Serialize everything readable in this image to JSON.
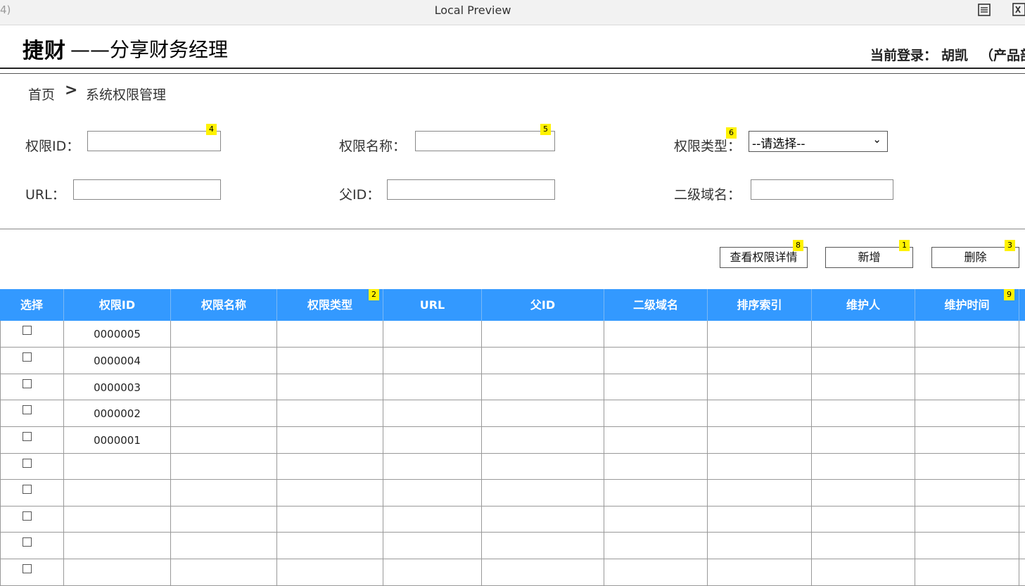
{
  "window": {
    "left_fragment": "4)",
    "title": "Local Preview"
  },
  "header": {
    "brand_bold": "捷财",
    "brand_rest": "——分享财务经理",
    "login_label": "当前登录：",
    "login_name": "胡凯",
    "login_dept": "（产品部"
  },
  "breadcrumb": {
    "home": "首页",
    "separator": ">",
    "current": "系统权限管理"
  },
  "form": {
    "perm_id_label": "权限ID：",
    "perm_name_label": "权限名称：",
    "perm_type_label": "权限类型：",
    "perm_type_value": "--请选择--",
    "url_label": "URL：",
    "parent_id_label": "父ID：",
    "subdomain_label": "二级域名："
  },
  "actions": {
    "view_detail": "查看权限详情",
    "add": "新增",
    "delete": "删除"
  },
  "badges": {
    "view_detail": "8",
    "add": "1",
    "delete": "3",
    "perm_type_col": "2",
    "maint_time_col": "9",
    "perm_id_input": "4",
    "perm_name_input": "5",
    "perm_type_select": "6"
  },
  "table": {
    "columns": [
      "选择",
      "权限ID",
      "权限名称",
      "权限类型",
      "URL",
      "父ID",
      "二级域名",
      "排序索引",
      "维护人",
      "维护时间"
    ],
    "rows": [
      {
        "id": "0000005"
      },
      {
        "id": "0000004"
      },
      {
        "id": "0000003"
      },
      {
        "id": "0000002"
      },
      {
        "id": "0000001"
      },
      {
        "id": ""
      },
      {
        "id": ""
      },
      {
        "id": ""
      },
      {
        "id": ""
      },
      {
        "id": ""
      }
    ]
  },
  "colors": {
    "table_header": "#3399ff",
    "badge": "#fff200"
  }
}
